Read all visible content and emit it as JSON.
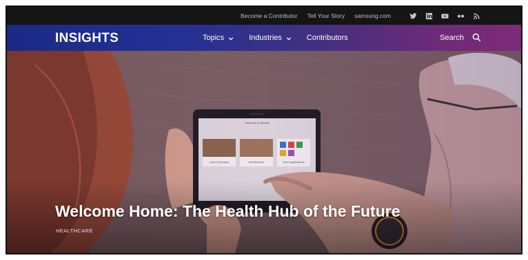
{
  "utility_bar": {
    "links": [
      "Become a Contributor",
      "Tell Your Story",
      "samsung.com"
    ],
    "social_icons": [
      "twitter-icon",
      "linkedin-icon",
      "youtube-icon",
      "flickr-icon",
      "rss-icon"
    ]
  },
  "nav": {
    "logo": "INSIGHTS",
    "items": [
      {
        "label": "Topics",
        "has_dropdown": true
      },
      {
        "label": "Industries",
        "has_dropdown": true
      },
      {
        "label": "Contributors",
        "has_dropdown": false
      }
    ],
    "search_label": "Search"
  },
  "hero": {
    "title": "Welcome Home: The Health Hub of the Future",
    "category": "HEALTHCARE",
    "tablet": {
      "brand": "SAMSUNG",
      "screen_title": "Welcome to Brenda",
      "tiles": [
        "Learn Exercises",
        "Activity Book",
        "More Applications"
      ]
    }
  },
  "colors": {
    "utility_bg": "#151515",
    "nav_gradient_start": "#1a2a86",
    "nav_gradient_end": "#7e2a77"
  }
}
